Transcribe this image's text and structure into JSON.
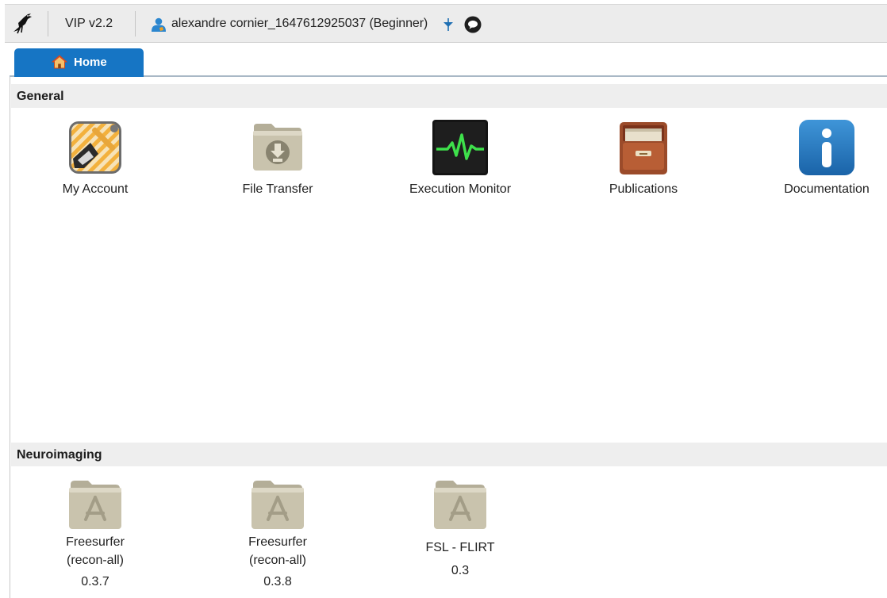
{
  "toolbar": {
    "logo_icon": "bird-logo-icon",
    "version": "VIP v2.2",
    "user_icon": "user-icon",
    "user_label": "alexandre cornier_1647612925037 (Beginner)",
    "menu_icon": "dropdown-arrow-icon",
    "chat_icon": "chat-bubble-icon"
  },
  "tabs": [
    {
      "label": "Home",
      "icon": "home-icon",
      "active": true,
      "color": "#1675c4"
    }
  ],
  "sections": {
    "general": {
      "title": "General",
      "items": [
        {
          "label": "My Account",
          "icon": "account-settings-icon"
        },
        {
          "label": "File Transfer",
          "icon": "download-folder-icon"
        },
        {
          "label": "Execution Monitor",
          "icon": "activity-monitor-icon"
        },
        {
          "label": "Publications",
          "icon": "filing-cabinet-icon"
        },
        {
          "label": "Documentation",
          "icon": "info-icon"
        }
      ]
    },
    "neuroimaging": {
      "title": "Neuroimaging",
      "items": [
        {
          "name_line1": "Freesurfer",
          "name_line2": "(recon-all)",
          "version": "0.3.7",
          "icon": "application-folder-icon"
        },
        {
          "name_line1": "Freesurfer",
          "name_line2": "(recon-all)",
          "version": "0.3.8",
          "icon": "application-folder-icon"
        },
        {
          "name_line1": "FSL - FLIRT",
          "version": "0.3",
          "icon": "application-folder-icon"
        }
      ]
    }
  }
}
